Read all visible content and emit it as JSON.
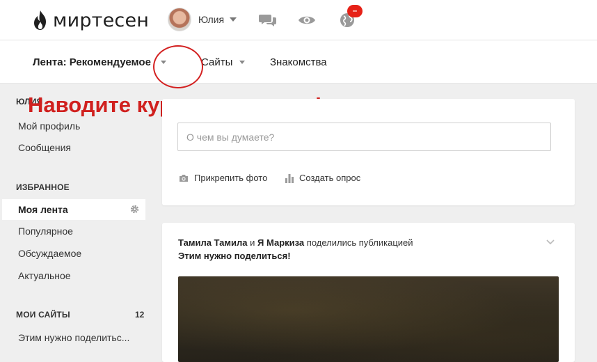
{
  "header": {
    "brand": "миртесен",
    "user_name": "Юлия",
    "notification_badge": "–",
    "icons": [
      "flame-logo-icon",
      "messages-icon",
      "eye-icon",
      "globe-icon"
    ]
  },
  "subnav": {
    "items": [
      {
        "label": "Лента: Рекомендуемое",
        "has_caret": true
      },
      {
        "label": "Сайты",
        "has_caret": true
      },
      {
        "label": "Знакомства",
        "has_caret": false
      }
    ]
  },
  "annotation": {
    "text": "Наводите курсор вот сюда!",
    "color": "#d0201e"
  },
  "sidebar": {
    "user_heading": "ЮЛИЯ",
    "user_items": [
      "Мой профиль",
      "Сообщения"
    ],
    "favorites_heading": "ИЗБРАННОЕ",
    "favorites_active": "Моя лента",
    "favorites_items": [
      "Популярное",
      "Обсуждаемое",
      "Актуальное"
    ],
    "my_sites_heading": "МОИ САЙТЫ",
    "my_sites_count": "12",
    "my_sites_items": [
      "Этим нужно поделитьс..."
    ]
  },
  "composer": {
    "placeholder": "О чем вы думаете?",
    "attach_photo": "Прикрепить фото",
    "create_poll": "Создать опрос"
  },
  "post": {
    "author1": "Тамила Тамила",
    "conj": "и",
    "author2": "Я Маркиза",
    "action": "поделились публикацией",
    "title": "Этим нужно поделиться!"
  },
  "colors": {
    "background": "#efefef",
    "annotation_red": "#d0201e",
    "badge_red": "#e62117"
  }
}
